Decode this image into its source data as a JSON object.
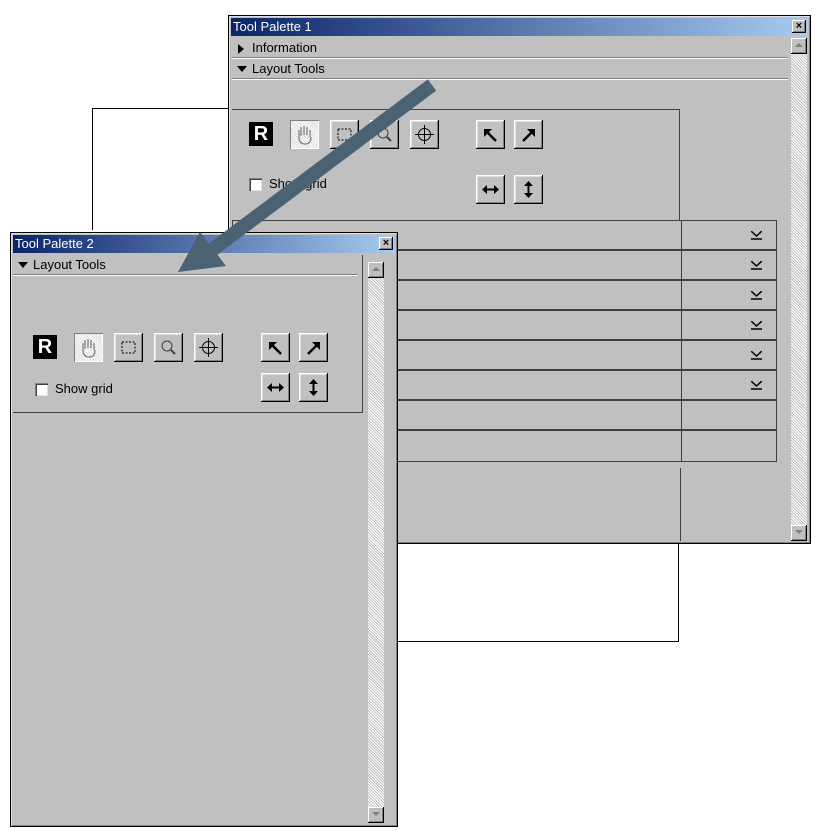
{
  "palette1": {
    "title": "Tool Palette 1",
    "close_glyph": "×",
    "sections": [
      {
        "label": "Information",
        "state": "collapsed"
      },
      {
        "label": "Layout Tools",
        "state": "expanded"
      }
    ],
    "show_grid_label": "Show grid",
    "show_grid_checked": false,
    "reset_label": "R"
  },
  "palette2": {
    "title": "Tool Palette 2",
    "close_glyph": "×",
    "section_label": "Layout Tools",
    "show_grid_label": "Show grid",
    "show_grid_checked": false,
    "reset_label": "R"
  },
  "tools": [
    {
      "name": "reset",
      "icon": "R"
    },
    {
      "name": "hand",
      "icon": "hand-icon",
      "selected": true
    },
    {
      "name": "marquee",
      "icon": "marquee-icon"
    },
    {
      "name": "zoom",
      "icon": "magnifier-icon"
    },
    {
      "name": "crosshair",
      "icon": "crosshair-icon"
    },
    {
      "name": "rotate-left",
      "icon": "rotate-left-icon"
    },
    {
      "name": "rotate-right",
      "icon": "rotate-right-icon"
    },
    {
      "name": "flip-horizontal",
      "icon": "flip-horizontal-icon"
    },
    {
      "name": "flip-vertical",
      "icon": "flip-vertical-icon"
    }
  ],
  "colors": {
    "title_start": "#0a246a",
    "title_end": "#a6caf0",
    "face": "#c0c0c0",
    "arrow": "#4a6272"
  }
}
